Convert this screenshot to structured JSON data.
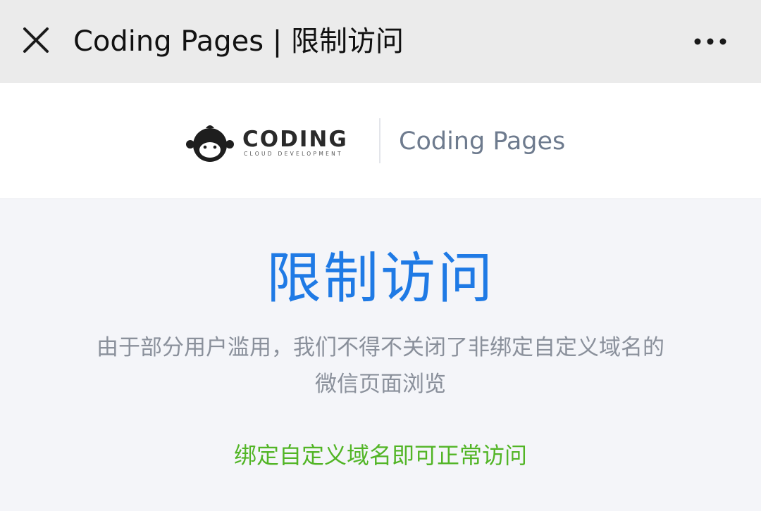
{
  "titlebar": {
    "title": "Coding Pages | 限制访问",
    "close_icon": "close-icon",
    "more_icon": "more-dots-icon"
  },
  "brand": {
    "logo_text": "CODING",
    "logo_tagline": "CLOUD DEVELOPMENT",
    "logo_icon": "monkey-mascot-icon",
    "product_name": "Coding Pages"
  },
  "main": {
    "heading": "限制访问",
    "notice_line1": "由于部分用户滥用，我们不得不关闭了非绑定自定义域名的",
    "notice_line2": "微信页面浏览",
    "hint": "绑定自定义域名即可正常访问"
  },
  "colors": {
    "titlebar_bg": "#ebebeb",
    "heading": "#1f7ae5",
    "notice": "#8a909b",
    "hint": "#52b526",
    "product": "#6e7b8e"
  }
}
